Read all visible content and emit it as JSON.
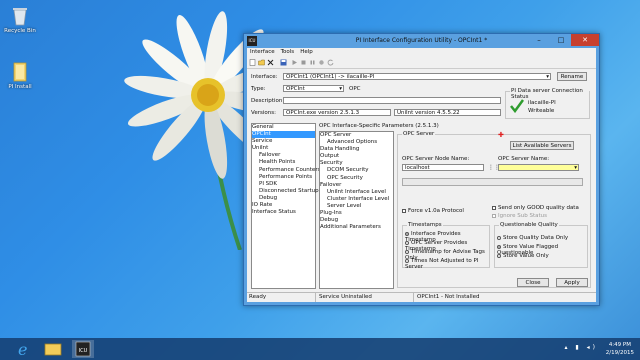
{
  "desktop": {
    "icons": [
      {
        "label": "Recycle Bin",
        "icon": "recycle-bin-icon"
      },
      {
        "label": "PI Install",
        "icon": "folder-icon"
      }
    ]
  },
  "window": {
    "title": "PI Interface Configuration Utility - OPCInt1 *",
    "app_icon_text": "ICU",
    "controls": {
      "minimize": "–",
      "maximize": "□",
      "close": "✕"
    },
    "menu": [
      "Interface",
      "Tools",
      "Help"
    ],
    "toolbar_icons": [
      "new-icon",
      "open-icon",
      "delete-icon",
      "save-icon",
      "play-icon",
      "stop-icon",
      "pause-icon",
      "record-icon",
      "refresh-icon"
    ],
    "interface_label": "Interface:",
    "interface_value": "OPCInt1 (OPCInt1) -> ilacaille-PI",
    "rename_label": "Rename",
    "type_label": "Type:",
    "type_value": "OPCInt",
    "type_desc": "OPC",
    "description_label": "Description:",
    "description_value": "",
    "versions_label": "Versions:",
    "exe_version": "OPCInt.exe version 2.5.1.3",
    "uniint_version": "UniInt version 4.5.5.22",
    "status_group_title": "PI Data server Connection Status",
    "status_server": "ilacaille-PI",
    "status_state": "Writeable",
    "nav_items": [
      {
        "label": "General",
        "indent": 0
      },
      {
        "label": "OPCInt",
        "indent": 0,
        "selected": true
      },
      {
        "label": "Service",
        "indent": 0
      },
      {
        "label": "UniInt",
        "indent": 0
      },
      {
        "label": "Failover",
        "indent": 1
      },
      {
        "label": "Health Points",
        "indent": 1
      },
      {
        "label": "Performance Counters",
        "indent": 1
      },
      {
        "label": "Performance Points",
        "indent": 1
      },
      {
        "label": "PI SDK",
        "indent": 1
      },
      {
        "label": "Disconnected Startup",
        "indent": 1
      },
      {
        "label": "Debug",
        "indent": 1
      },
      {
        "label": "IO Rate",
        "indent": 0
      },
      {
        "label": "Interface Status",
        "indent": 0
      }
    ],
    "params_title": "OPC Interface-Specific Parameters (2.5.1.3)",
    "param_items": [
      {
        "label": "OPC Server",
        "indent": 0
      },
      {
        "label": "Advanced Options",
        "indent": 1
      },
      {
        "label": "Data Handling",
        "indent": 0
      },
      {
        "label": "Output",
        "indent": 0
      },
      {
        "label": "Security",
        "indent": 0
      },
      {
        "label": "DCOM Security",
        "indent": 1
      },
      {
        "label": "OPC Security",
        "indent": 1
      },
      {
        "label": "Failover",
        "indent": 0
      },
      {
        "label": "UniInt Interface Level",
        "indent": 1
      },
      {
        "label": "Cluster Interface Level",
        "indent": 1
      },
      {
        "label": "Server Level",
        "indent": 1
      },
      {
        "label": "Plug-Ins",
        "indent": 0
      },
      {
        "label": "Debug",
        "indent": 0
      },
      {
        "label": "Additional Parameters",
        "indent": 0
      }
    ],
    "opc_server_group": "OPC Server",
    "list_servers_button": "List Available Servers",
    "node_name_label": "OPC Server Node Name:",
    "node_name_value": "localhost",
    "server_name_label": "OPC Server Name:",
    "server_name_value": "",
    "force_v10a_label": "Force v1.0a Protocol",
    "send_good_label": "Send only GOOD quality data",
    "ignore_substatus_label": "Ignore Sub Status",
    "timestamps_group": "Timestamps",
    "timestamp_options": [
      {
        "label": "Interface Provides Timestamp",
        "selected": true
      },
      {
        "label": "OPC Server Provides Timestamp",
        "selected": false
      },
      {
        "label": "Timestamp for Advise Tags Only",
        "selected": false
      },
      {
        "label": "Times Not Adjusted to PI Server",
        "selected": false
      }
    ],
    "quality_group": "Questionable Quality",
    "quality_options": [
      {
        "label": "Store Quality Data Only",
        "selected": false
      },
      {
        "label": "Store Value Flagged Questionable",
        "selected": true
      },
      {
        "label": "Store Value Only",
        "selected": false
      }
    ],
    "close_button": "Close",
    "apply_button": "Apply",
    "status_bar": [
      "Ready",
      "Service Uninstalled",
      "OPCInt1 - Not Installed"
    ]
  },
  "taskbar": {
    "apps": [
      "ie-icon",
      "explorer-icon",
      "icu-icon"
    ],
    "time": "4:49 PM",
    "date": "2/19/2015"
  }
}
